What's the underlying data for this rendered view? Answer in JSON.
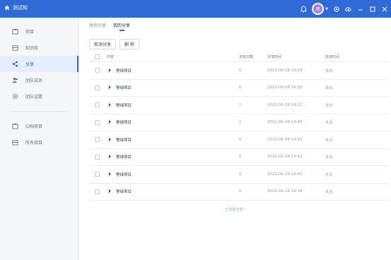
{
  "app": {
    "title": "测试知"
  },
  "topbar": {
    "avatar_text": "我",
    "icons": [
      "bell-icon",
      "avatar",
      "settings-icon",
      "cloud-icon",
      "minimize-icon",
      "maximize-icon",
      "close-icon"
    ]
  },
  "sidebar": {
    "items": [
      {
        "label": "项目",
        "icon": "project-icon"
      },
      {
        "label": "知识库",
        "icon": "knowledge-icon"
      },
      {
        "label": "分享",
        "icon": "share-icon",
        "active": true
      },
      {
        "label": "团队成员",
        "icon": "team-members-icon"
      },
      {
        "label": "团队设置",
        "icon": "team-settings-icon"
      }
    ],
    "items2": [
      {
        "label": "归档项目",
        "icon": "archive-icon"
      },
      {
        "label": "所有项目",
        "icon": "all-projects-icon"
      }
    ]
  },
  "main": {
    "tabs": [
      {
        "label": "收到分享"
      },
      {
        "label": "我的分享",
        "active": true
      }
    ],
    "actions": {
      "cancel_share": "取消分享",
      "delete": "删 除"
    },
    "table": {
      "headers": {
        "name": "内容",
        "views": "浏览次数",
        "time": "分享时间",
        "expiry": "失效时间"
      },
      "rows": [
        {
          "name": "警绿项目",
          "views": "0",
          "time": "2021-06-28 14:58",
          "expiry": "永久"
        },
        {
          "name": "警绿项目",
          "views": "0",
          "time": "2021-06-28 14:58",
          "expiry": "永久"
        },
        {
          "name": "警绿项目",
          "views": "1",
          "time": "2021-06-28 14:57",
          "expiry": "永久"
        },
        {
          "name": "警绿项目",
          "views": "1",
          "time": "2021-06-28 14:45",
          "expiry": "永久"
        },
        {
          "name": "警绿项目",
          "views": "0",
          "time": "2021-06-28 14:42",
          "expiry": "永久"
        },
        {
          "name": "警绿项目",
          "views": "0",
          "time": "2021-06-28 14:42",
          "expiry": "永久"
        },
        {
          "name": "警绿项目",
          "views": "0",
          "time": "2021-06-28 14:42",
          "expiry": "永久"
        },
        {
          "name": "警绿项目",
          "views": "0",
          "time": "2021-06-28 14:39",
          "expiry": "永久"
        }
      ]
    },
    "footer": "已加载全部~"
  },
  "colors": {
    "accent": "#2f6bd6",
    "avatar": "#a877e6"
  }
}
